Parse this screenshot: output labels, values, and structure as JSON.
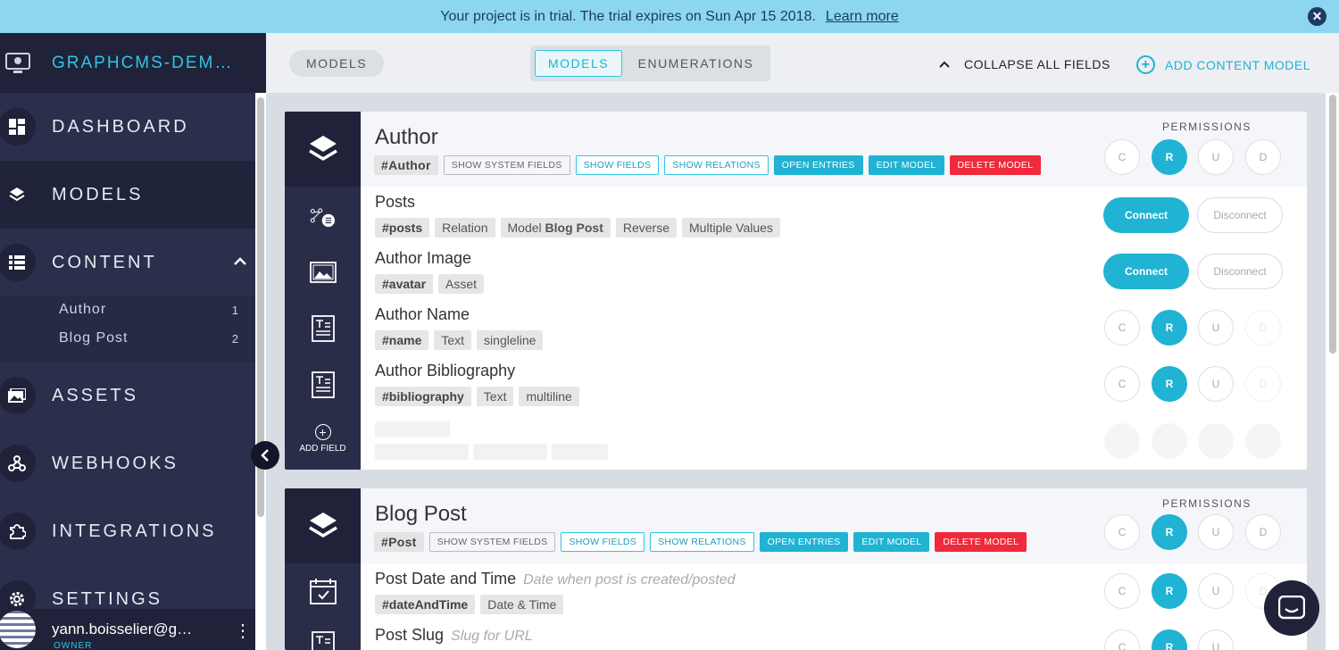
{
  "banner": {
    "text": "Your project is in trial. The trial expires on Sun Apr 15 2018.",
    "link": "Learn more",
    "close": "✕"
  },
  "sidebar": {
    "project": "GRAPHCMS-DEM…",
    "nav": [
      {
        "label": "DASHBOARD",
        "icon": "dashboard-icon"
      },
      {
        "label": "MODELS",
        "icon": "layers-icon"
      },
      {
        "label": "CONTENT",
        "icon": "list-icon"
      },
      {
        "label": "ASSETS",
        "icon": "images-icon"
      },
      {
        "label": "WEBHOOKS",
        "icon": "webhook-icon"
      },
      {
        "label": "INTEGRATIONS",
        "icon": "puzzle-icon"
      },
      {
        "label": "SETTINGS",
        "icon": "gear-icon"
      }
    ],
    "content_items": [
      {
        "label": "Author",
        "count": "1"
      },
      {
        "label": "Blog Post",
        "count": "2"
      }
    ],
    "user": {
      "email": "yann.boisselier@g…",
      "role": "OWNER"
    }
  },
  "toolbar": {
    "models_pill": "MODELS",
    "tab_models": "MODELS",
    "tab_enumerations": "ENUMERATIONS",
    "collapse_all": "COLLAPSE ALL FIELDS",
    "add_model": "ADD CONTENT MODEL"
  },
  "labels": {
    "permissions": "PERMISSIONS",
    "show_system_fields": "SHOW SYSTEM FIELDS",
    "show_fields": "SHOW FIELDS",
    "show_relations": "SHOW RELATIONS",
    "open_entries": "OPEN ENTRIES",
    "edit_model": "EDIT MODEL",
    "delete_model": "DELETE MODEL",
    "connect": "Connect",
    "disconnect": "Disconnect",
    "add_field": "ADD FIELD",
    "perm_c": "C",
    "perm_r": "R",
    "perm_u": "U",
    "perm_d": "D"
  },
  "models": [
    {
      "title": "Author",
      "api_id": "#Author",
      "fields": [
        {
          "name": "Posts",
          "tags": [
            "#posts",
            "Relation",
            "Model",
            "Blog Post",
            "Reverse",
            "Multiple Values"
          ]
        },
        {
          "name": "Author Image",
          "tags": [
            "#avatar",
            "Asset"
          ]
        },
        {
          "name": "Author Name",
          "tags": [
            "#name",
            "Text",
            "singleline"
          ]
        },
        {
          "name": "Author Bibliography",
          "tags": [
            "#bibliography",
            "Text",
            "multiline"
          ]
        }
      ]
    },
    {
      "title": "Blog Post",
      "api_id": "#Post",
      "fields": [
        {
          "name": "Post Date and Time",
          "description": "Date when post is created/posted",
          "tags": [
            "#dateAndTime",
            "Date & Time"
          ]
        },
        {
          "name": "Post Slug",
          "description": "Slug for URL"
        }
      ]
    }
  ]
}
